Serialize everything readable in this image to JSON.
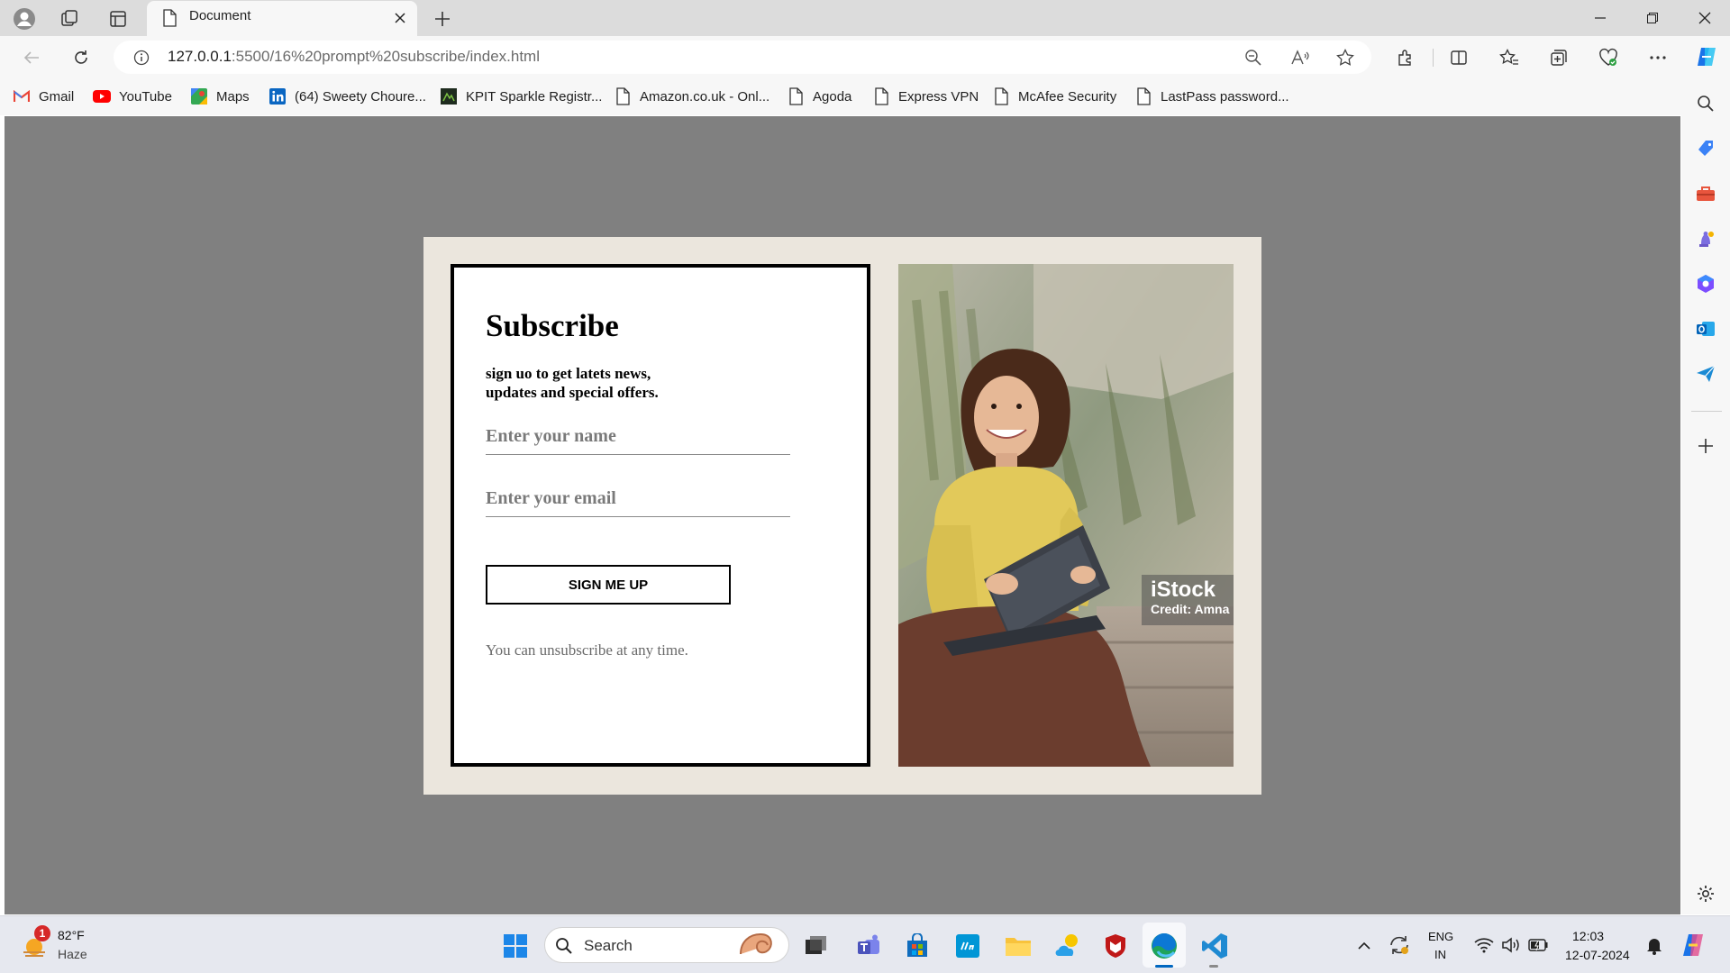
{
  "browser": {
    "tab_title": "Document",
    "url_host": "127.0.0.1",
    "url_rest": ":5500/16%20prompt%20subscribe/index.html"
  },
  "bookmarks": [
    {
      "label": "Gmail",
      "icon": "gmail-icon"
    },
    {
      "label": "YouTube",
      "icon": "youtube-icon"
    },
    {
      "label": "Maps",
      "icon": "maps-icon"
    },
    {
      "label": "(64) Sweety Choure...",
      "icon": "linkedin-icon"
    },
    {
      "label": "KPIT Sparkle Registr...",
      "icon": "kpit-icon"
    },
    {
      "label": "Amazon.co.uk - Onl...",
      "icon": "page-icon"
    },
    {
      "label": "Agoda",
      "icon": "page-icon"
    },
    {
      "label": "Express VPN",
      "icon": "page-icon"
    },
    {
      "label": "McAfee Security",
      "icon": "page-icon"
    },
    {
      "label": "LastPass password...",
      "icon": "page-icon"
    }
  ],
  "subscribe": {
    "title": "Subscribe",
    "text_line1": "sign uo to get latets news,",
    "text_line2": "updates and special offers.",
    "name_placeholder": "Enter your name",
    "email_placeholder": "Enter your email",
    "button_label": "SIGN ME UP",
    "note": "You can unsubscribe at any time."
  },
  "photo": {
    "logo": "iStock",
    "credit": "Credit: Amna"
  },
  "taskbar": {
    "weather_temp": "82°F",
    "weather_desc": "Haze",
    "weather_badge": "1",
    "search_label": "Search",
    "lang_line1": "ENG",
    "lang_line2": "IN",
    "time": "12:03",
    "date": "12-07-2024"
  },
  "colors": {
    "viewport_bg": "#808080",
    "card_bg": "#ebe6dd",
    "accent": "#0067c0"
  }
}
